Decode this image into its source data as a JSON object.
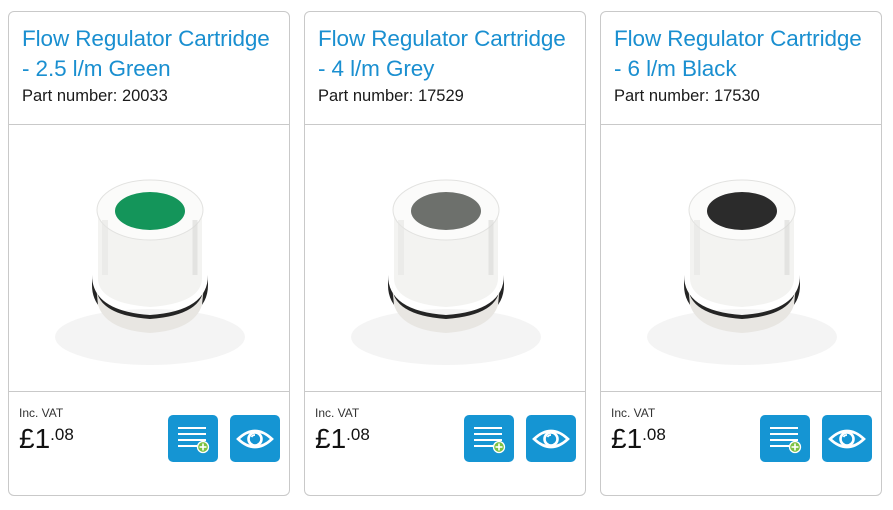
{
  "products": [
    {
      "title": "Flow Regulator Cartridge - 2.5 l/m Green",
      "part_number": "Part number: 20033",
      "vat_label": "Inc. VAT",
      "price_major": "£1",
      "price_minor": ".08",
      "insert_color": "#14955a",
      "add_to_list_icon": "add-to-list-icon",
      "view_icon": "eye-icon"
    },
    {
      "title": "Flow Regulator Cartridge - 4 l/m Grey",
      "part_number": "Part number: 17529",
      "vat_label": "Inc. VAT",
      "price_major": "£1",
      "price_minor": ".08",
      "insert_color": "#6d706c",
      "add_to_list_icon": "add-to-list-icon",
      "view_icon": "eye-icon"
    },
    {
      "title": "Flow Regulator Cartridge - 6 l/m Black",
      "part_number": "Part number: 17530",
      "vat_label": "Inc. VAT",
      "price_major": "£1",
      "price_minor": ".08",
      "insert_color": "#2b2b2b",
      "add_to_list_icon": "add-to-list-icon",
      "view_icon": "eye-icon"
    }
  ],
  "colors": {
    "title": "#1a8fd0",
    "button": "#1595d3",
    "border": "#c9c9c9"
  }
}
